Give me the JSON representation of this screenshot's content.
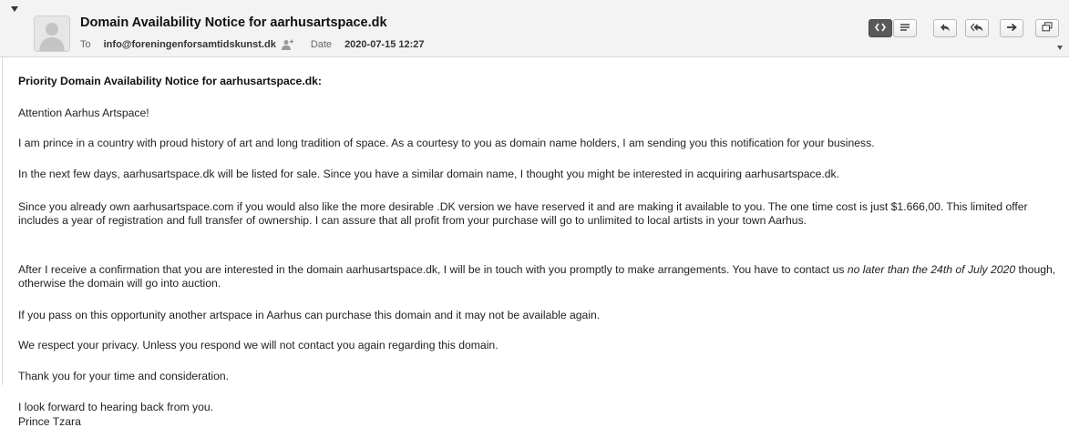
{
  "header": {
    "subject": "Domain Availability Notice for aarhusartspace.dk",
    "to_label": "To",
    "to_value": "info@foreningenforsamtidskunst.dk",
    "date_label": "Date",
    "date_value": "2020-07-15 12:27"
  },
  "toolbar": {
    "icons": [
      "html-source-icon",
      "plain-text-icon",
      "reply-icon",
      "reply-all-icon",
      "forward-icon",
      "open-window-icon"
    ]
  },
  "message": {
    "heading": "Priority Domain Availability Notice for aarhusartspace.dk:",
    "greeting": "Attention Aarhus Artspace!",
    "p1": "I am prince in a country with proud history of art and long tradition of space. As a courtesy to you as domain name holders, I am sending you this notification for your business.",
    "p2": "In the next few days, aarhusartspace.dk will be listed for sale. Since you have a similar domain name, I thought you might be interested in acquiring aarhusartspace.dk.",
    "p3": "Since you already own aarhusartspace.com if you would also like the more desirable .DK version we have reserved it and are making it available to you. The one time cost is just $1.666,00. This limited offer includes a year of registration and full transfer of ownership. I can assure that all profit from your purchase will go to unlimited to local artists in your town Aarhus.",
    "p4_start": "After I receive a confirmation that you are interested in the domain aarhusartspace.dk, I will be in touch with you promptly to make arrangements. You have to contact us ",
    "p4_em": "no later than the 24th of July 2020",
    "p4_end": " though, otherwise the domain will go into auction.",
    "p5": "If you pass on this opportunity another artspace in Aarhus can purchase this domain and it may not be available again.",
    "p6": "We respect your privacy. Unless you respond we will not contact you again regarding this domain.",
    "p7": "Thank you for your time and consideration.",
    "p8": "I look forward to hearing back from you.",
    "signature": "Prince Tzara"
  }
}
